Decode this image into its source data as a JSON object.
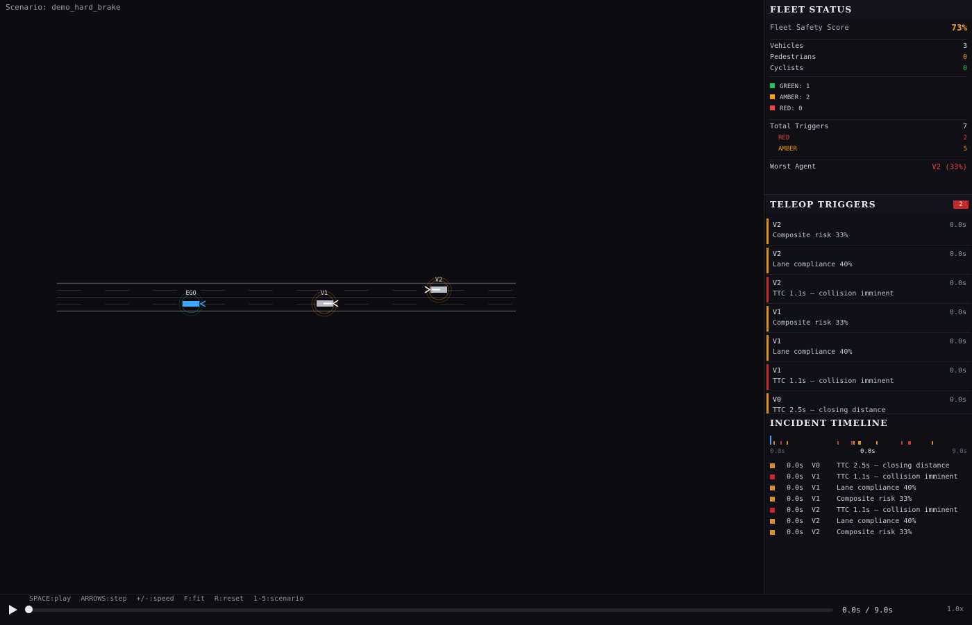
{
  "scenario_label": "Scenario: demo_hard_brake",
  "colors": {
    "green": "#22c55e",
    "amber": "#f59e0b",
    "red": "#ef4444",
    "ego": "#3ea7ff",
    "score": "#f5a524"
  },
  "road": {
    "agents": [
      {
        "id": "ego",
        "label": "EGO",
        "ring": "green"
      },
      {
        "id": "v1",
        "label": "V1",
        "ring": "amber"
      },
      {
        "id": "v2",
        "label": "V2",
        "ring": "amber"
      }
    ]
  },
  "fleet": {
    "title": "FLEET STATUS",
    "score_label": "Fleet Safety Score",
    "score_value": "73%",
    "counts": [
      {
        "label": "Vehicles",
        "value": "3"
      },
      {
        "label": "Pedestrians",
        "value": "0"
      },
      {
        "label": "Cyclists",
        "value": "0"
      }
    ],
    "status": [
      {
        "label": "GREEN: 1",
        "color": "green"
      },
      {
        "label": "AMBER: 2",
        "color": "amber"
      },
      {
        "label": "RED: 0",
        "color": "red"
      }
    ],
    "triggers_label": "Total Triggers",
    "triggers_value": "7",
    "red_label": "RED",
    "red_value": "2",
    "amber_label": "AMBER",
    "amber_value": "5",
    "worst_label": "Worst Agent",
    "worst_value": "V2 (33%)"
  },
  "teleop": {
    "title": "TELEOP TRIGGERS",
    "badge": "2",
    "items": [
      {
        "agent": "V2",
        "time": "0.0s",
        "message": "Composite risk 33%",
        "level": "amber"
      },
      {
        "agent": "V2",
        "time": "0.0s",
        "message": "Lane compliance 40%",
        "level": "amber"
      },
      {
        "agent": "V2",
        "time": "0.0s",
        "message": "TTC 1.1s — collision imminent",
        "level": "red"
      },
      {
        "agent": "V1",
        "time": "0.0s",
        "message": "Composite risk 33%",
        "level": "amber"
      },
      {
        "agent": "V1",
        "time": "0.0s",
        "message": "Lane compliance 40%",
        "level": "amber"
      },
      {
        "agent": "V1",
        "time": "0.0s",
        "message": "TTC 1.1s — collision imminent",
        "level": "red"
      },
      {
        "agent": "V0",
        "time": "0.0s",
        "message": "TTC 2.5s — closing distance",
        "level": "amber"
      }
    ]
  },
  "timeline": {
    "title": "INCIDENT TIMELINE",
    "start_label": "0.0s",
    "current_label": "0.0s",
    "end_label": "9.0s",
    "events": [
      {
        "time": "0.0s",
        "agent": "V0",
        "message": "TTC 2.5s — closing distance",
        "level": "amber"
      },
      {
        "time": "0.0s",
        "agent": "V1",
        "message": "TTC 1.1s — collision imminent",
        "level": "red"
      },
      {
        "time": "0.0s",
        "agent": "V1",
        "message": "Lane compliance 40%",
        "level": "amber"
      },
      {
        "time": "0.0s",
        "agent": "V1",
        "message": "Composite risk 33%",
        "level": "amber"
      },
      {
        "time": "0.0s",
        "agent": "V2",
        "message": "TTC 1.1s — collision imminent",
        "level": "red"
      },
      {
        "time": "0.0s",
        "agent": "V2",
        "message": "Lane compliance 40%",
        "level": "amber"
      },
      {
        "time": "0.0s",
        "agent": "V2",
        "message": "Composite risk 33%",
        "level": "amber"
      }
    ]
  },
  "controls": {
    "hotkeys": "SPACE:play  ARROWS:step  +/-:speed  F:fit  R:reset  1-5:scenario",
    "time_display": "0.0s / 9.0s",
    "speed": "1.0x",
    "progress": 0.0
  }
}
